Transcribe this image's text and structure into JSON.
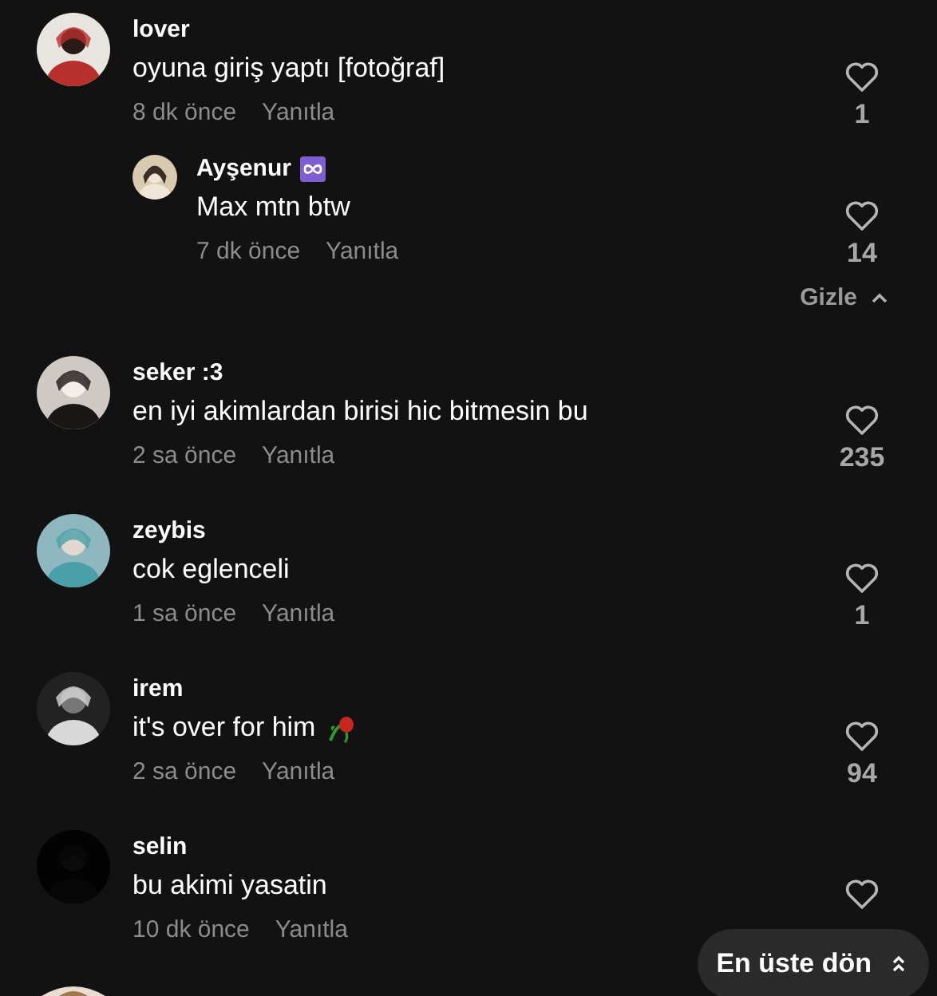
{
  "comments": [
    {
      "user": "lover",
      "text": "oyuna giriş yaptı [fotoğraf]",
      "time": "8 dk önce",
      "reply": "Yanıtla",
      "likes": "1",
      "rose": false,
      "replies": [
        {
          "user": "Ayşenur",
          "badge": true,
          "text": "Max mtn btw",
          "time": "7 dk önce",
          "reply": "Yanıtla",
          "likes": "14"
        }
      ],
      "hide_label": "Gizle"
    },
    {
      "user": "seker :3",
      "text": "en iyi akimlardan birisi hic bitmesin bu",
      "time": "2 sa önce",
      "reply": "Yanıtla",
      "likes": "235",
      "rose": false
    },
    {
      "user": "zeybis",
      "text": "cok eglenceli",
      "time": "1 sa önce",
      "reply": "Yanıtla",
      "likes": "1",
      "rose": false
    },
    {
      "user": "irem",
      "text": "it's over for him",
      "time": "2 sa önce",
      "reply": "Yanıtla",
      "likes": "94",
      "rose": true
    },
    {
      "user": "selin",
      "text": "bu akimi yasatin",
      "time": "10 dk önce",
      "reply": "Yanıtla",
      "rose": false
    }
  ],
  "more_below": true,
  "back_to_top": {
    "label": "En üste dön"
  }
}
